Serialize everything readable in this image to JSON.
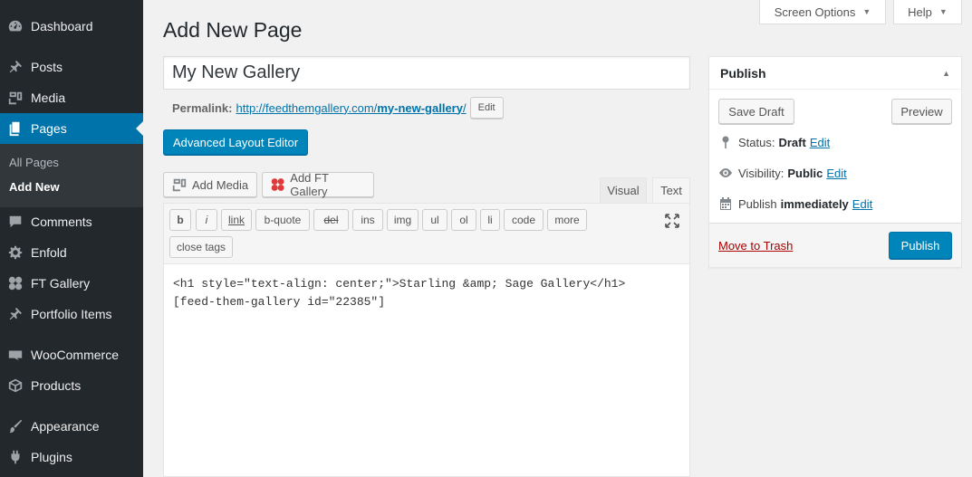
{
  "sidebar": {
    "items": [
      {
        "label": "Dashboard",
        "icon": "dashboard-icon"
      },
      {
        "label": "Posts",
        "icon": "pin-icon"
      },
      {
        "label": "Media",
        "icon": "media-icon"
      },
      {
        "label": "Pages",
        "icon": "pages-icon"
      },
      {
        "label": "Comments",
        "icon": "comment-icon"
      },
      {
        "label": "Enfold",
        "icon": "gear-icon"
      },
      {
        "label": "FT Gallery",
        "icon": "gallery-icon"
      },
      {
        "label": "Portfolio Items",
        "icon": "pin-icon"
      },
      {
        "label": "WooCommerce",
        "icon": "woocommerce-icon"
      },
      {
        "label": "Products",
        "icon": "box-icon"
      },
      {
        "label": "Appearance",
        "icon": "brush-icon"
      },
      {
        "label": "Plugins",
        "icon": "plug-icon"
      }
    ],
    "submenu": [
      "All Pages",
      "Add New"
    ],
    "active_color": "#0073aa"
  },
  "top_tabs": {
    "screen_options": "Screen Options",
    "help": "Help"
  },
  "page": {
    "heading": "Add New Page",
    "title_value": "My New Gallery",
    "permalink_label": "Permalink:",
    "permalink_base": "http://feedthemgallery.com/",
    "permalink_slug": "my-new-gallery",
    "permalink_trailing": "/",
    "permalink_edit": "Edit",
    "layout_editor_button": "Advanced Layout Editor"
  },
  "editor": {
    "add_media": "Add Media",
    "add_ft_gallery": "Add FT Gallery",
    "tab_visual": "Visual",
    "tab_text": "Text",
    "quicktags": [
      "b",
      "i",
      "link",
      "b-quote",
      "del",
      "ins",
      "img",
      "ul",
      "ol",
      "li",
      "code",
      "more",
      "close tags"
    ],
    "content_line1": "<h1 style=\"text-align: center;\">Starling &amp; Sage Gallery</h1>",
    "content_line2": "[feed-them-gallery id=\"22385\"]"
  },
  "publish": {
    "title": "Publish",
    "save_draft": "Save Draft",
    "preview": "Preview",
    "status_label": "Status:",
    "status_value": "Draft",
    "visibility_label": "Visibility:",
    "visibility_value": "Public",
    "publish_label": "Publish",
    "publish_value": "immediately",
    "edit": "Edit",
    "move_to_trash": "Move to Trash",
    "publish_button": "Publish",
    "trash_color": "#a00",
    "primary_color": "#0085ba"
  }
}
